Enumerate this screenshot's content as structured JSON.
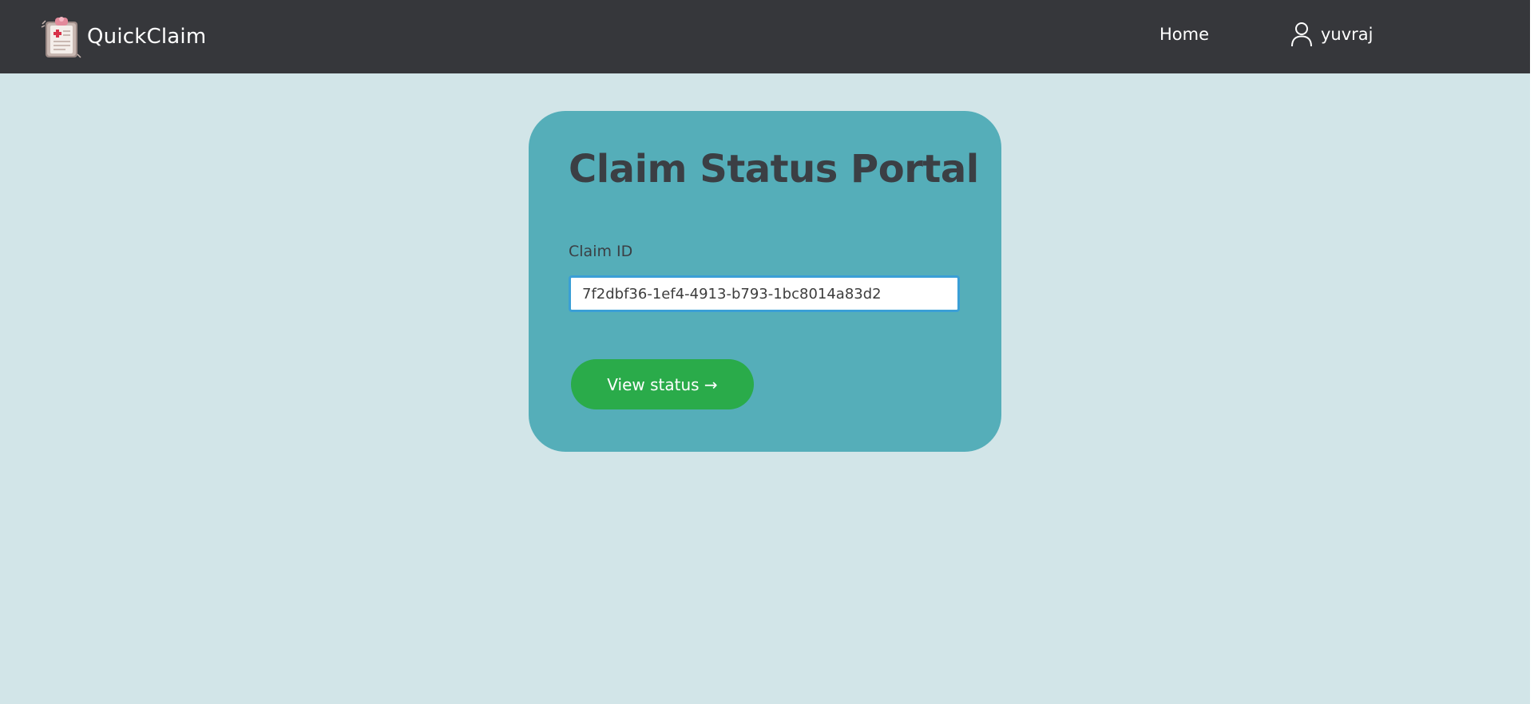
{
  "navbar": {
    "brand_name": "QuickClaim",
    "brand_icon": "clipboard-medical-icon",
    "home_label": "Home",
    "user_icon": "user-icon",
    "username": "yuvraj"
  },
  "claim_form": {
    "title": "Claim Status Portal",
    "claim_id_label": "Claim ID",
    "claim_id_value": "7f2dbf36-1ef4-4913-b793-1bc8014a83d2",
    "submit_label": "View status →"
  },
  "colors": {
    "navbar_bg": "#36373b",
    "page_bg": "#d2e5e8",
    "card_bg": "#55aeb9",
    "button_bg": "#2aab4a",
    "input_focus_border": "#3a9fd6",
    "title_text": "#3b3f44"
  }
}
